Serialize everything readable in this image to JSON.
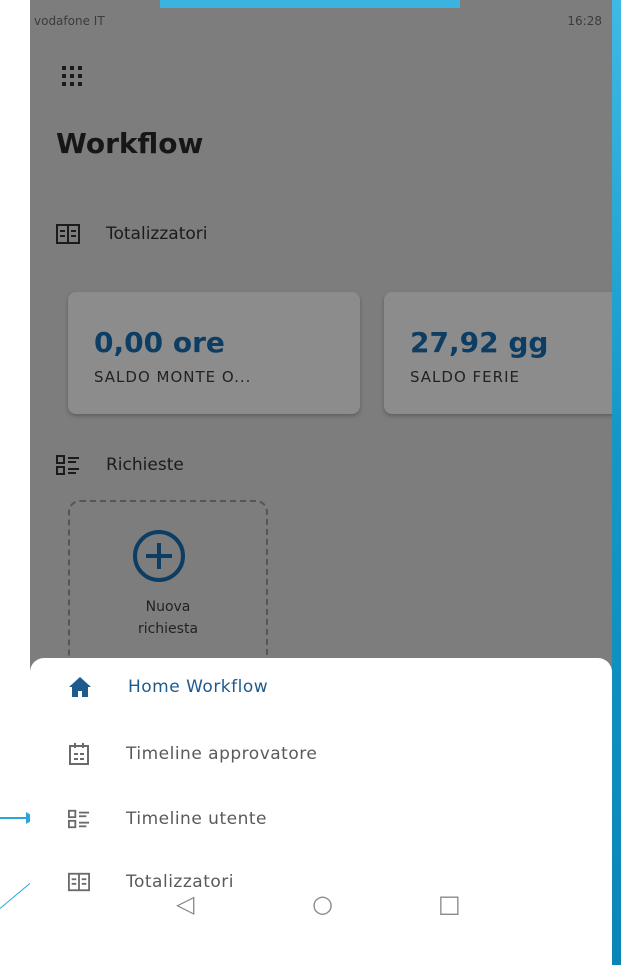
{
  "status_bar": {
    "carrier": "vodafone IT",
    "time": "16:28"
  },
  "header": {
    "title": "Workflow"
  },
  "totalizzatori": {
    "label": "Totalizzatori",
    "cards": [
      {
        "value": "0,00 ore",
        "label": "SALDO MONTE O..."
      },
      {
        "value": "27,92 gg",
        "label": "SALDO FERIE"
      }
    ]
  },
  "richieste": {
    "label": "Richieste",
    "new_request_label": "Nuova\nrichiesta"
  },
  "menu": {
    "items": [
      {
        "label": "Home Workflow",
        "icon": "home-icon",
        "active": true
      },
      {
        "label": "Timeline approvatore",
        "icon": "calendar-icon",
        "active": false
      },
      {
        "label": "Timeline utente",
        "icon": "list-icon",
        "active": false
      },
      {
        "label": "Totalizzatori",
        "icon": "table-icon",
        "active": false
      }
    ]
  },
  "navbar": {
    "back": "◁",
    "home": "○",
    "recent": "□"
  },
  "colors": {
    "accent": "#0d3d62",
    "active": "#1f5a8c",
    "overlay": "#7d7d7d",
    "slide_teal": "#2aa7d8"
  }
}
